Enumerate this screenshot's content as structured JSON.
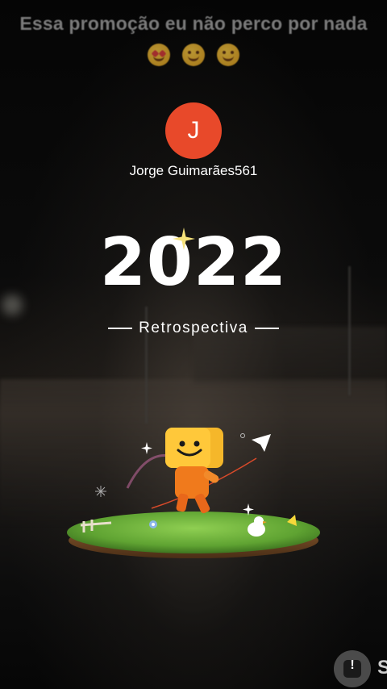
{
  "caption": {
    "text": "Essa promoção eu não perco por nada",
    "emojis": [
      "heart-eyes-emoji",
      "grinning-emoji",
      "laughing-emoji"
    ]
  },
  "profile": {
    "initial": "J",
    "avatar_color": "#e8492a",
    "username": "Jorge Guimarães561"
  },
  "banner": {
    "year": "2022",
    "subtitle": "Retrospectiva"
  },
  "action": {
    "icon": "info-square-icon",
    "cut_label": "S"
  }
}
